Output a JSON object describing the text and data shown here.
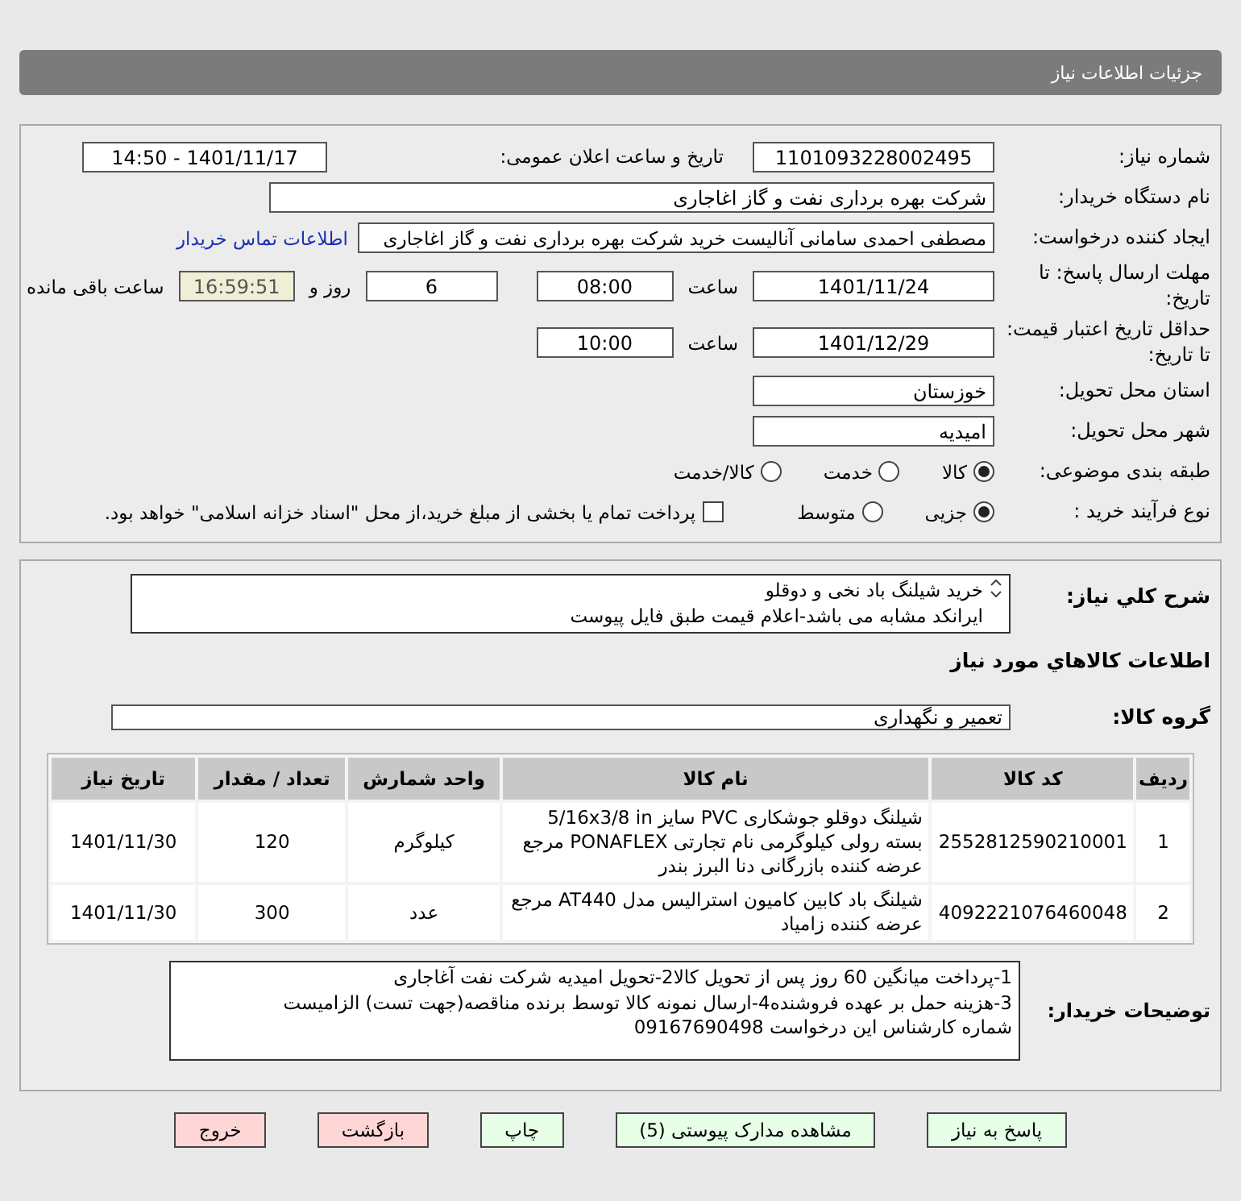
{
  "header": {
    "title": "جزئیات اطلاعات نیاز"
  },
  "details": {
    "need_number": {
      "label": "شماره نیاز:",
      "value": "1101093228002495"
    },
    "announce": {
      "label": "تاریخ و ساعت اعلان عمومی:",
      "value": "1401/11/17 - 14:50"
    },
    "buyer_org": {
      "label": "نام دستگاه خریدار:",
      "value": "شرکت بهره برداری نفت و گاز اغاجاری"
    },
    "requester": {
      "label": "ایجاد کننده درخواست:",
      "value": "مصطفی احمدی سامانی آنالیست خرید شرکت بهره برداری نفت و گاز اغاجاری",
      "link": "اطلاعات تماس خریدار"
    },
    "deadline": {
      "label": "مهلت ارسال پاسخ: تا تاریخ:",
      "date": "1401/11/24",
      "time_label": "ساعت",
      "time": "08:00",
      "days": "6",
      "days_label": "روز و",
      "remaining": "16:59:51",
      "remaining_label": "ساعت باقی مانده"
    },
    "validity": {
      "label": "حداقل تاریخ اعتبار قیمت: تا تاریخ:",
      "date": "1401/12/29",
      "time_label": "ساعت",
      "time": "10:00"
    },
    "province": {
      "label": "استان محل تحویل:",
      "value": "خوزستان"
    },
    "city": {
      "label": "شهر محل تحویل:",
      "value": "امیدیه"
    },
    "category": {
      "label": "طبقه بندی موضوعی:",
      "options": [
        {
          "label": "کالا",
          "selected": true
        },
        {
          "label": "خدمت",
          "selected": false
        },
        {
          "label": "کالا/خدمت",
          "selected": false
        }
      ]
    },
    "process": {
      "label": "نوع فرآیند خرید :",
      "options": [
        {
          "label": "جزیی",
          "selected": true
        },
        {
          "label": "متوسط",
          "selected": false
        }
      ],
      "payment": {
        "label": "پرداخت تمام یا بخشی از مبلغ خرید،از محل \"اسناد خزانه اسلامی\" خواهد بود.",
        "checked": false
      }
    }
  },
  "summary": {
    "description": {
      "label": "شرح کلي نیاز:",
      "text": "خرید شیلنگ باد نخی و دوقلو\nایرانکد مشابه می باشد-اعلام قیمت طبق فایل پیوست"
    },
    "items_title": "اطلاعات کالاهاي مورد نیاز",
    "group": {
      "label": "گروه کالا:",
      "value": "تعمیر و نگهداری"
    },
    "table": {
      "columns": [
        "ردیف",
        "کد کالا",
        "نام کالا",
        "واحد شمارش",
        "تعداد / مقدار",
        "تاریخ نیاز"
      ],
      "rows": [
        [
          "1",
          "2552812590210001",
          "شیلنگ دوقلو جوشکاری PVC سایز 5/16x3/8 in بسته رولی کیلوگرمی نام تجارتی PONAFLEX مرجع عرضه کننده بازرگانی دنا البرز بندر",
          "کیلوگرم",
          "120",
          "1401/11/30"
        ],
        [
          "2",
          "4092221076460048",
          "شیلنگ باد کابین کامیون استرالیس مدل AT440 مرجع عرضه کننده زامیاد",
          "عدد",
          "300",
          "1401/11/30"
        ]
      ]
    },
    "notes": {
      "label": "توضیحات خریدار:",
      "text": "1-پرداخت میانگین 60 روز پس از تحویل کالا2-تحویل امیدیه شرکت نفت آغاجاری\n3-هزینه حمل بر عهده فروشنده4-ارسال نمونه کالا توسط برنده مناقصه(جهت تست) الزامیست\nشماره کارشناس این درخواست 09167690498"
    }
  },
  "buttons": [
    {
      "label": "پاسخ به نیاز",
      "kind": "go"
    },
    {
      "label": "مشاهده مدارک پیوستی (5)",
      "kind": "go"
    },
    {
      "label": "چاپ",
      "kind": "go"
    },
    {
      "label": "بازگشت",
      "kind": "stop"
    },
    {
      "label": "خروج",
      "kind": "stop"
    }
  ]
}
